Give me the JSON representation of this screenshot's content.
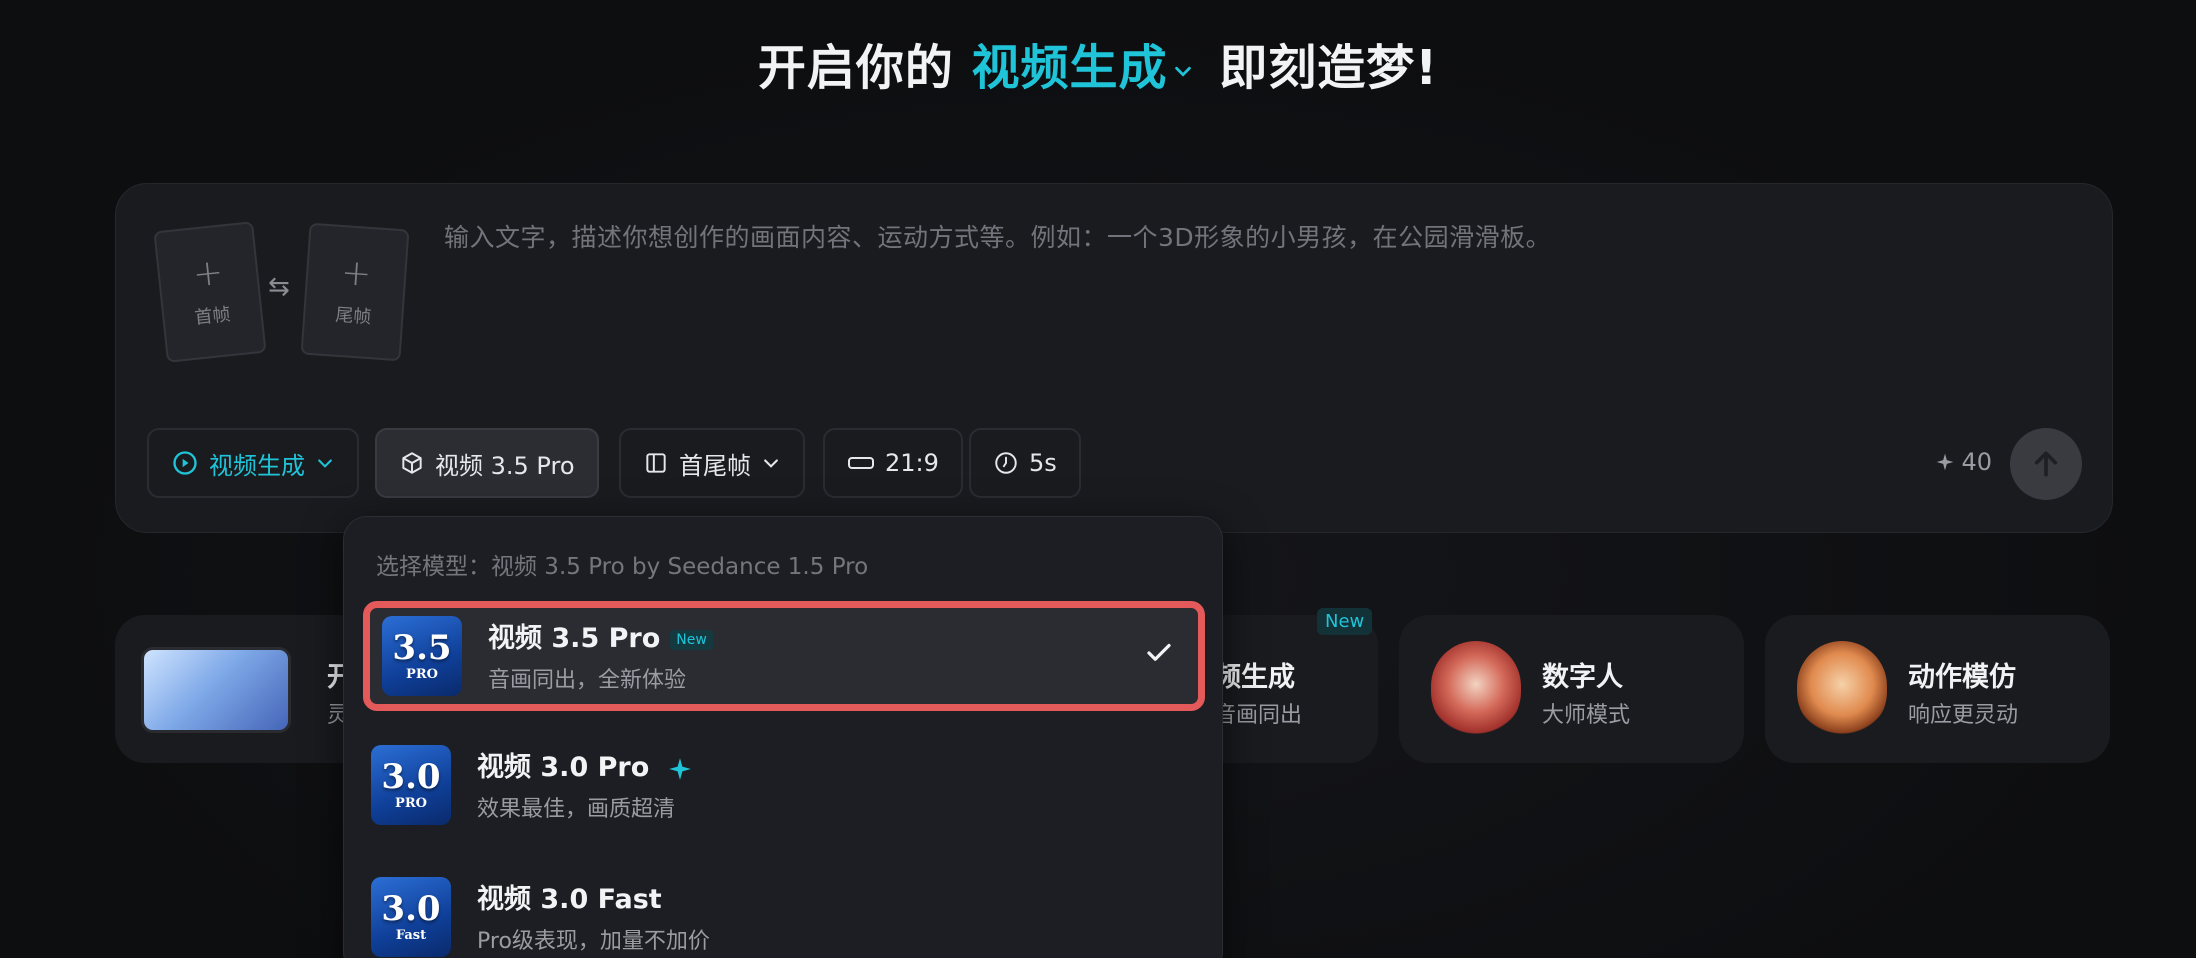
{
  "headline": {
    "prefix": "开启你的",
    "mode": "视频生成",
    "suffix": "即刻造梦!"
  },
  "composer": {
    "first_frame_label": "首帧",
    "last_frame_label": "尾帧",
    "swap_icon": "⇆",
    "placeholder": "输入文字，描述你想创作的画面内容、运动方式等。例如：一个3D形象的小男孩，在公园滑滑板。",
    "toolbar": {
      "mode": "视频生成",
      "model": "视频 3.5 Pro",
      "frames": "首尾帧",
      "ratio": "21:9",
      "duration": "5s"
    },
    "credits": "40"
  },
  "cards": [
    {
      "title": "开",
      "subtitle": "灵"
    },
    {
      "title": "频生成",
      "subtitle": "音画同出",
      "badge": "New"
    },
    {
      "title": "数字人",
      "subtitle": "大师模式"
    },
    {
      "title": "动作模仿",
      "subtitle": "响应更灵动"
    }
  ],
  "dropdown": {
    "header": "选择模型：视频 3.5 Pro by Seedance 1.5 Pro",
    "options": [
      {
        "name": "视频 3.5 Pro",
        "tag": "New",
        "desc": "音画同出，全新体验",
        "thumb_num": "3.5",
        "thumb_tier": "PRO",
        "selected": true
      },
      {
        "name": "视频 3.0 Pro",
        "desc": "效果最佳，画质超清",
        "thumb_num": "3.0",
        "thumb_tier": "PRO",
        "selected": false
      },
      {
        "name": "视频 3.0 Fast",
        "desc": "Pro级表现，加量不加价",
        "thumb_num": "3.0",
        "thumb_tier": "Fast",
        "selected": false
      }
    ]
  },
  "colors": {
    "accent": "#20c4d8",
    "highlight_border": "#e45a5a",
    "background": "#0d0e10",
    "panel": "#1a1b1f"
  }
}
